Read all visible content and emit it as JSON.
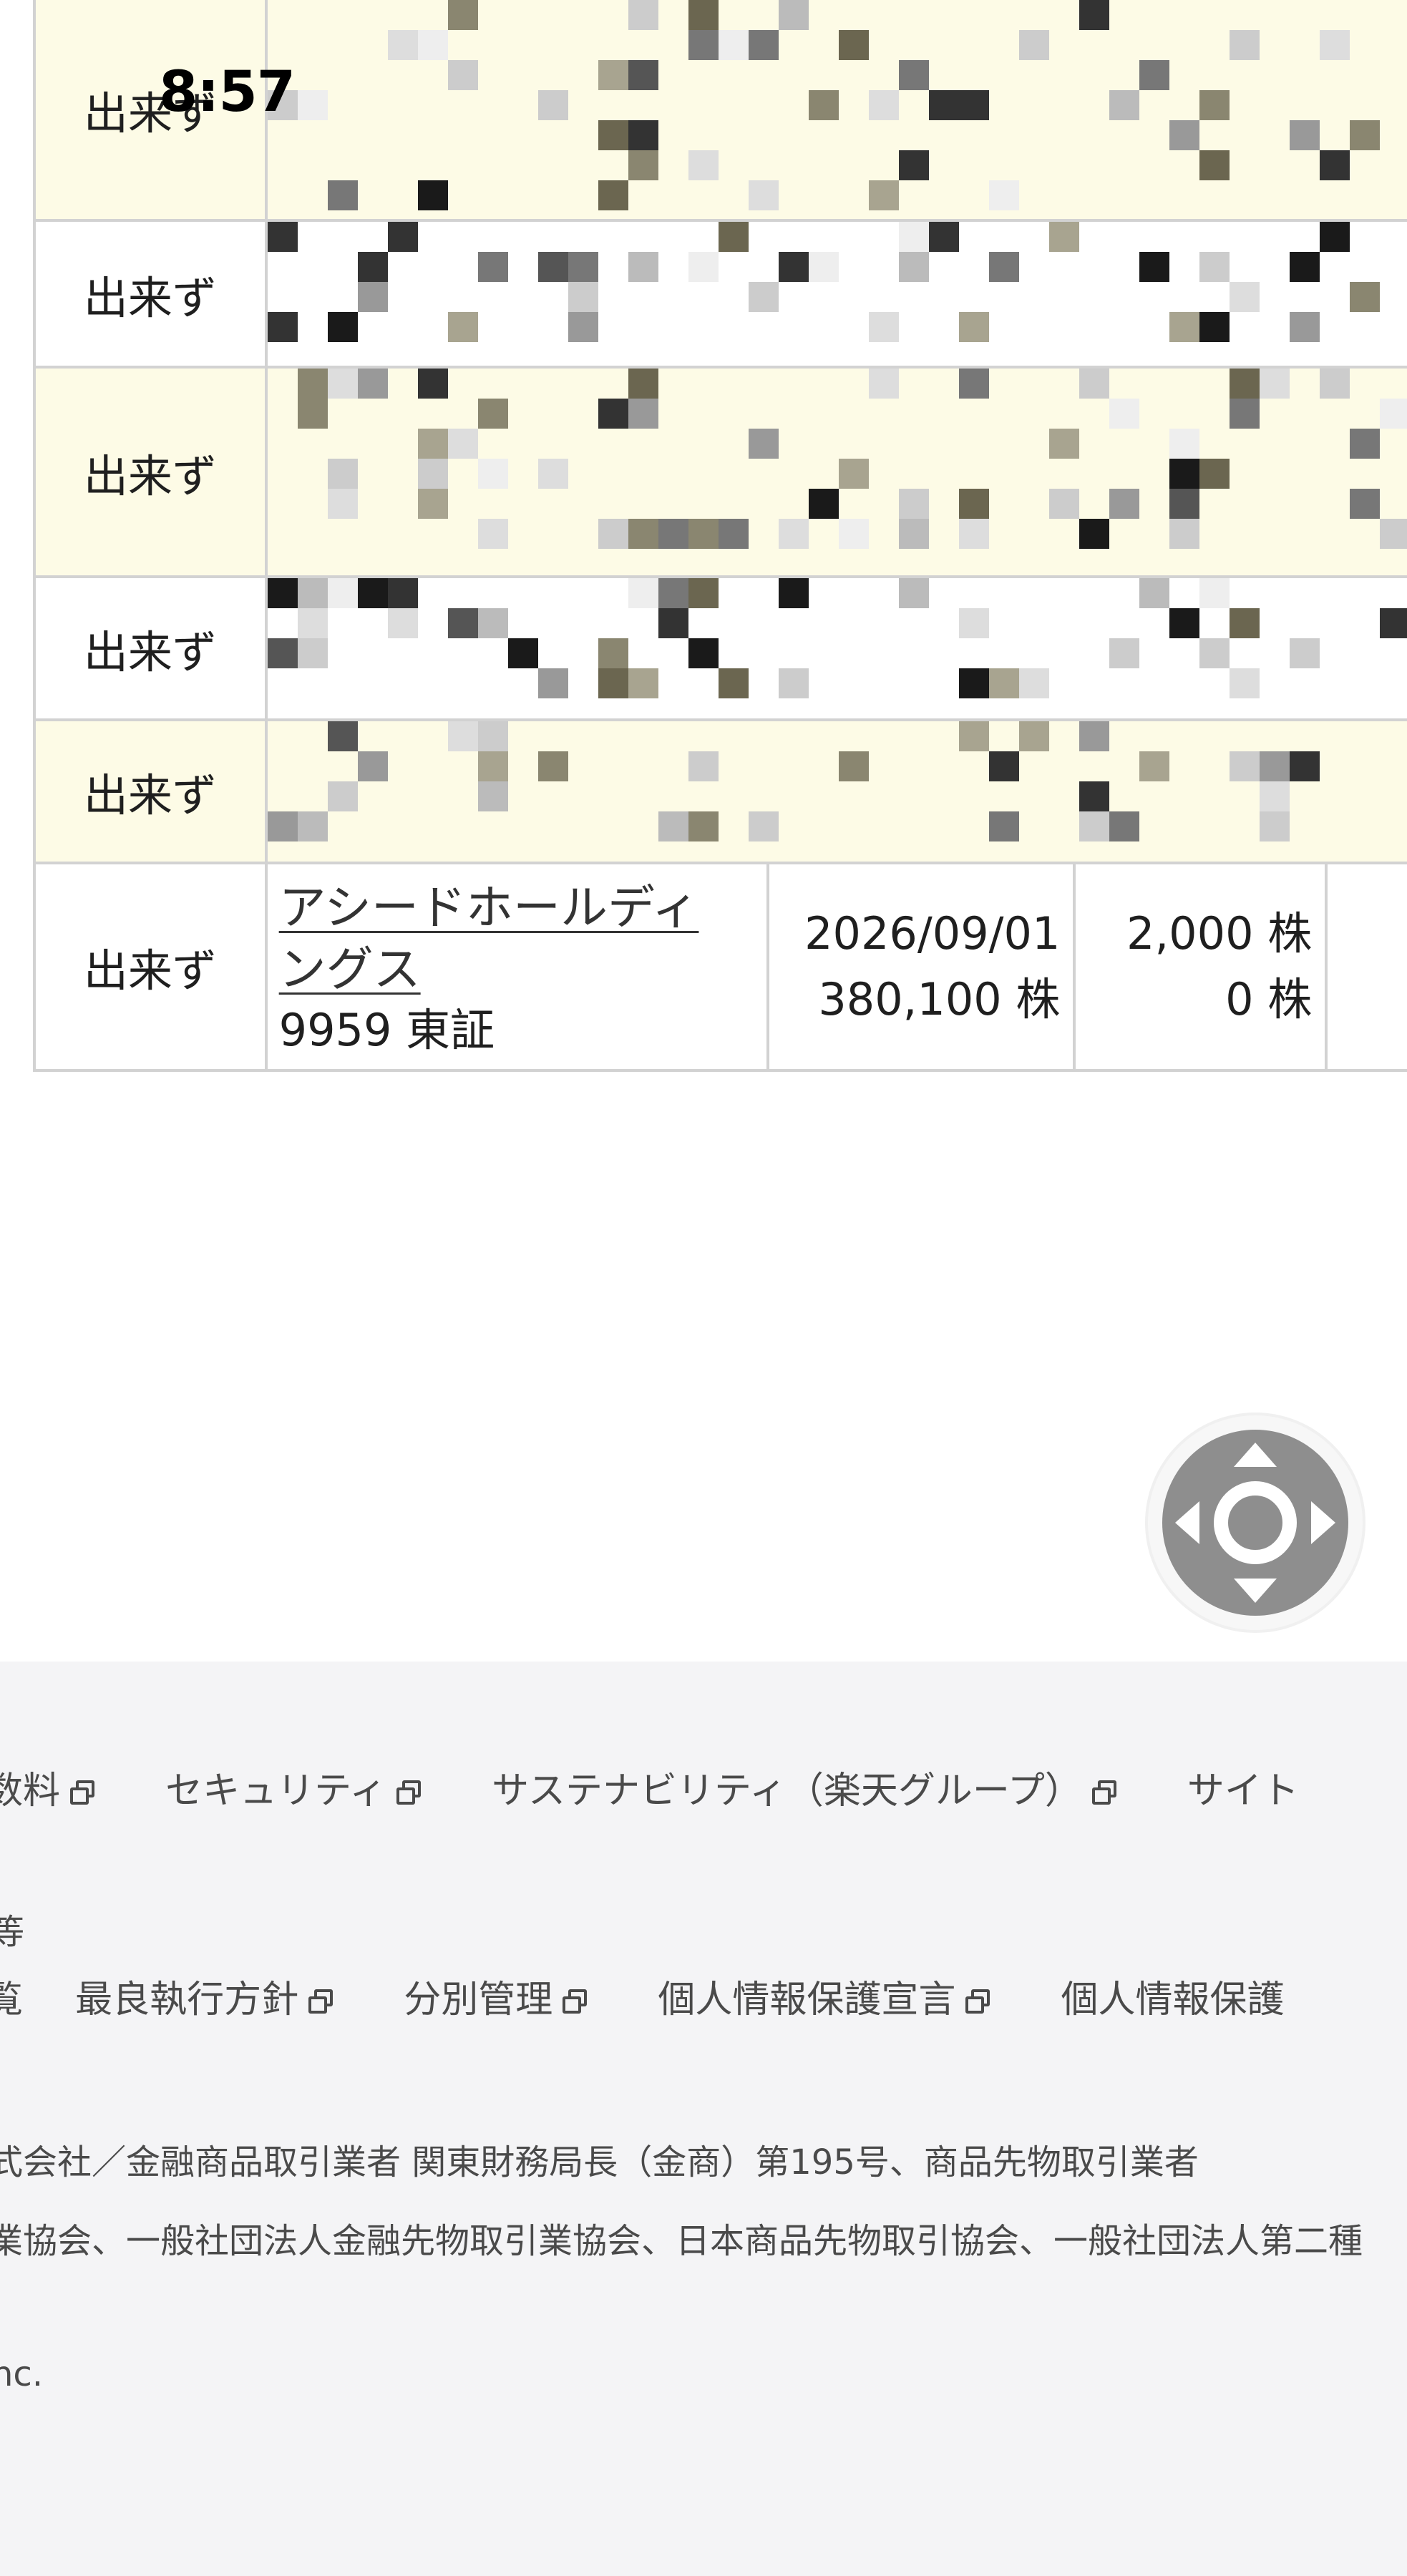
{
  "status_bar": {
    "time": "8:57"
  },
  "orders": {
    "rows": [
      {
        "status": "出来ず"
      },
      {
        "status": "出来ず"
      },
      {
        "status": "出来ず"
      },
      {
        "status": "出来ず"
      },
      {
        "status": "出来ず"
      }
    ],
    "last_row": {
      "status": "出来ず",
      "name_line1": "アシードホールディ",
      "name_line2": "ングス",
      "code_market": "9959 東証",
      "date": "2026/09/01",
      "date_qty": "380,100 株",
      "qty_ordered": "2,000 株",
      "qty_filled": "0 株"
    }
  },
  "footer": {
    "links_row1": [
      {
        "label": "数料"
      },
      {
        "label": "セキュリティ"
      },
      {
        "label": "サステナビリティ（楽天グループ）"
      },
      {
        "label": "サイト"
      }
    ],
    "section_label": "等",
    "links_row2_prefix": "覧",
    "links_row2": [
      {
        "label": "最良執行方針"
      },
      {
        "label": "分別管理"
      },
      {
        "label": "個人情報保護宣言"
      },
      {
        "label": "個人情報保護"
      }
    ],
    "company_line1": "式会社／金融商品取引業者 関東財務局長（金商）第195号、商品先物取引業者",
    "company_line2": "業協会、一般社団法人金融先物取引業協会、日本商品先物取引協会、一般社団法人第二種",
    "copyright": "nc."
  },
  "colors": {
    "row_highlight": "#fdfbe6",
    "border": "#d2d2d2",
    "footer_bg": "#f4f4f6",
    "joystick": "#8e8e8e"
  }
}
